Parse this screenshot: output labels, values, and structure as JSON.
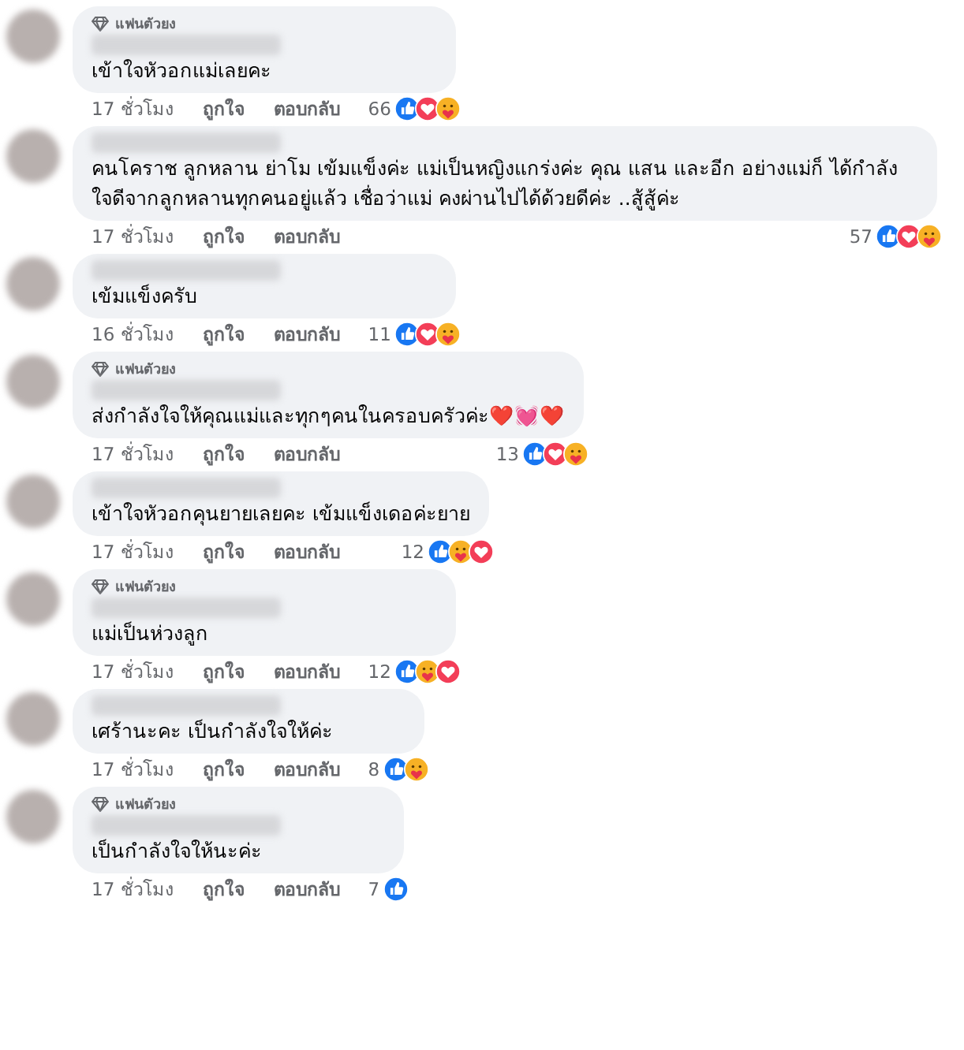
{
  "comments": [
    {
      "badge": "แฟนตัวยง",
      "text": "เข้าใจหัวอกแม่เลยคะ",
      "time": "17 ชั่วโมง",
      "like": "ถูกใจ",
      "reply": "ตอบกลับ",
      "count": "66",
      "reactions": [
        {
          "kind": "like"
        },
        {
          "kind": "love"
        },
        {
          "kind": "care"
        }
      ]
    },
    {
      "text": "คนโคราช ลูกหลาน ย่าโม เข้มแข็งค่ะ แม่เป็นหญิงแกร่งค่ะ คุณ แสน และอีก อย่างแม่ก็ ได้กำลังใจดีจากลูกหลานทุกคนอยู่แล้ว เชื่อว่าแม่ คงผ่านไปได้ด้วยดีค่ะ ..สู้สู้ค่ะ",
      "time": "17 ชั่วโมง",
      "like": "ถูกใจ",
      "reply": "ตอบกลับ",
      "count": "57",
      "reactions": [
        {
          "kind": "like"
        },
        {
          "kind": "love"
        },
        {
          "kind": "care"
        }
      ]
    },
    {
      "text": "เข้มแข็งครับ",
      "time": "16 ชั่วโมง",
      "like": "ถูกใจ",
      "reply": "ตอบกลับ",
      "count": "11",
      "reactions": [
        {
          "kind": "like"
        },
        {
          "kind": "love"
        },
        {
          "kind": "care"
        }
      ]
    },
    {
      "badge": "แฟนตัวยง",
      "text": "ส่งกำลังใจให้คุณแม่และทุกๆคนในครอบครัวค่ะ❤️💓❤️",
      "time": "17 ชั่วโมง",
      "like": "ถูกใจ",
      "reply": "ตอบกลับ",
      "count": "13",
      "reactions": [
        {
          "kind": "like"
        },
        {
          "kind": "love"
        },
        {
          "kind": "care"
        }
      ]
    },
    {
      "text": "เข้าใจหัวอกคุนยายเลยคะ เข้มแข็งเดอค่ะยาย",
      "time": "17 ชั่วโมง",
      "like": "ถูกใจ",
      "reply": "ตอบกลับ",
      "count": "12",
      "reactions": [
        {
          "kind": "like"
        },
        {
          "kind": "care"
        },
        {
          "kind": "love"
        }
      ]
    },
    {
      "badge": "แฟนตัวยง",
      "text": "แม่เป็นห่วงลูก",
      "time": "17 ชั่วโมง",
      "like": "ถูกใจ",
      "reply": "ตอบกลับ",
      "count": "12",
      "reactions": [
        {
          "kind": "like"
        },
        {
          "kind": "care"
        },
        {
          "kind": "love"
        }
      ]
    },
    {
      "text": "เศร้านะคะ เป็นกำลังใจให้ค่ะ",
      "time": "17 ชั่วโมง",
      "like": "ถูกใจ",
      "reply": "ตอบกลับ",
      "count": "8",
      "reactions": [
        {
          "kind": "like"
        },
        {
          "kind": "care"
        }
      ]
    },
    {
      "badge": "แฟนตัวยง",
      "text": "เป็นกำลังใจให้นะค่ะ",
      "time": "17 ชั่วโมง",
      "like": "ถูกใจ",
      "reply": "ตอบกลับ",
      "count": "7",
      "reactions": [
        {
          "kind": "like"
        }
      ]
    }
  ]
}
